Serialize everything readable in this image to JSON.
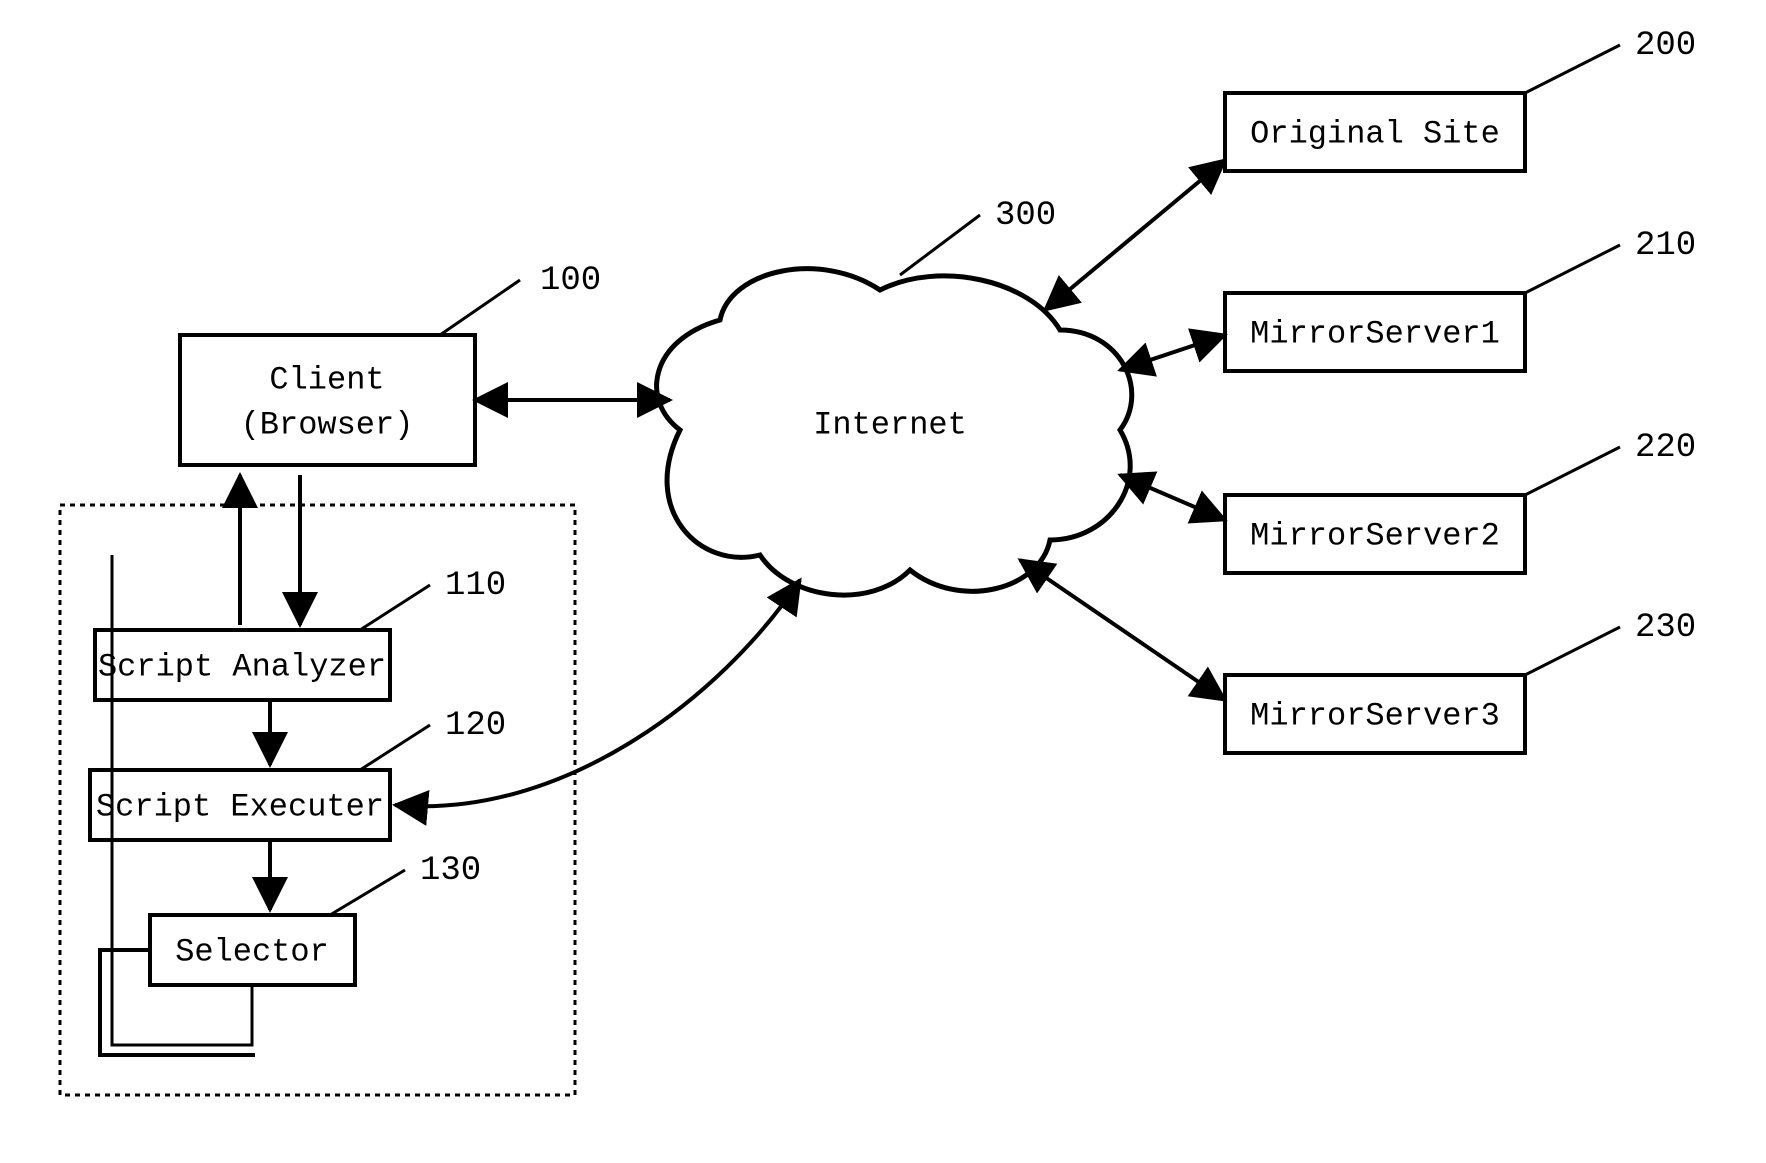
{
  "boxes": {
    "client": {
      "line1": "Client",
      "line2": "(Browser)",
      "ref": "100"
    },
    "script_analyzer": {
      "label": "Script Analyzer",
      "ref": "110"
    },
    "script_executer": {
      "label": "Script Executer",
      "ref": "120"
    },
    "selector": {
      "label": "Selector",
      "ref": "130"
    },
    "internet": {
      "label": "Internet",
      "ref": "300"
    },
    "original_site": {
      "label": "Original Site",
      "ref": "200"
    },
    "mirror1": {
      "label": "MirrorServer1",
      "ref": "210"
    },
    "mirror2": {
      "label": "MirrorServer2",
      "ref": "220"
    },
    "mirror3": {
      "label": "MirrorServer3",
      "ref": "230"
    }
  }
}
